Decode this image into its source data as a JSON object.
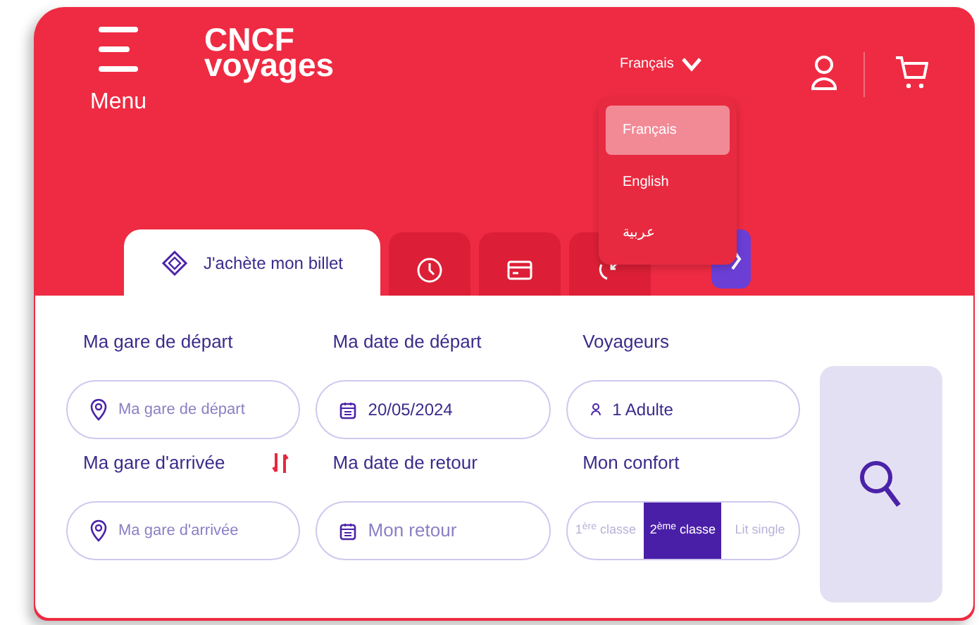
{
  "header": {
    "menu_label": "Menu",
    "logo_top": "CNCF",
    "logo_bottom": "voyages",
    "language": "Français"
  },
  "language_menu": [
    {
      "label": "Français",
      "selected": true
    },
    {
      "label": "English",
      "selected": false
    },
    {
      "label": "عربية",
      "selected": false
    }
  ],
  "tabs": [
    {
      "kind": "ticket",
      "label": "J'achète mon billet",
      "selected": true
    },
    {
      "kind": "clock",
      "selected": false
    },
    {
      "kind": "card",
      "selected": false
    },
    {
      "kind": "arrows",
      "selected": false
    }
  ],
  "form": {
    "departure": {
      "label": "Ma gare de départ",
      "placeholder": "Ma gare de départ"
    },
    "departure_date": {
      "label": "Ma date de départ",
      "value": "20/05/2024"
    },
    "travellers": {
      "label": "Voyageurs",
      "value": "1 Adulte"
    },
    "arrival": {
      "label": "Ma gare d'arrivée",
      "placeholder": "Ma gare d'arrivée"
    },
    "return_date": {
      "label": "Ma date de retour",
      "placeholder": "Mon retour"
    },
    "comfort": {
      "label": "Mon confort",
      "options": [
        {
          "label": "1$^{ère}$ classe",
          "selected": false
        },
        {
          "label": "2$^{ème}$ classe",
          "selected": true
        },
        {
          "label": "Lit single",
          "selected": false
        }
      ]
    }
  }
}
